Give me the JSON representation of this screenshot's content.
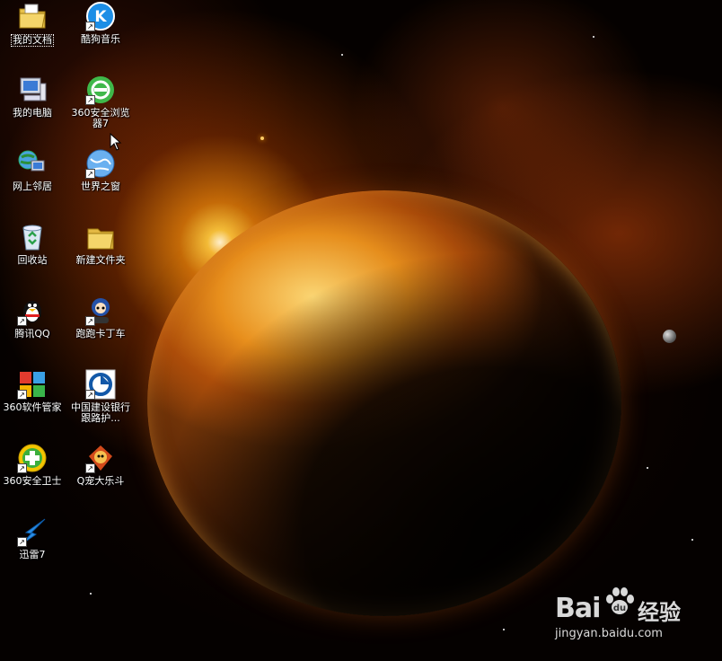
{
  "desktop": {
    "icons": [
      {
        "label": "我的文档",
        "icon": "folder-documents-icon",
        "selected": true,
        "shortcut": false
      },
      {
        "label": "酷狗音乐",
        "icon": "kugou-music-icon",
        "selected": false,
        "shortcut": true
      },
      {
        "label": "我的电脑",
        "icon": "my-computer-icon",
        "selected": false,
        "shortcut": false
      },
      {
        "label": "360安全浏览器7",
        "icon": "360-browser-icon",
        "selected": false,
        "shortcut": true
      },
      {
        "label": "网上邻居",
        "icon": "network-places-icon",
        "selected": false,
        "shortcut": false
      },
      {
        "label": "世界之窗",
        "icon": "theworld-browser-icon",
        "selected": false,
        "shortcut": true
      },
      {
        "label": "回收站",
        "icon": "recycle-bin-icon",
        "selected": false,
        "shortcut": false
      },
      {
        "label": "新建文件夹",
        "icon": "folder-icon",
        "selected": false,
        "shortcut": false
      },
      {
        "label": "腾讯QQ",
        "icon": "qq-penguin-icon",
        "selected": false,
        "shortcut": true
      },
      {
        "label": "跑跑卡丁车",
        "icon": "kart-rider-icon",
        "selected": false,
        "shortcut": true
      },
      {
        "label": "360软件管家",
        "icon": "360-software-manager-icon",
        "selected": false,
        "shortcut": true
      },
      {
        "label": "中国建设银行跟路护...",
        "icon": "ccb-bank-icon",
        "selected": false,
        "shortcut": true
      },
      {
        "label": "360安全卫士",
        "icon": "360-safeguard-icon",
        "selected": false,
        "shortcut": true
      },
      {
        "label": "Q宠大乐斗",
        "icon": "q-pet-game-icon",
        "selected": false,
        "shortcut": true
      },
      {
        "label": "迅雷7",
        "icon": "thunder-download-icon",
        "selected": false,
        "shortcut": true
      }
    ]
  },
  "watermark": {
    "logo_left": "Bai",
    "logo_right": "经验",
    "url": "jingyan.baidu.com"
  },
  "colors": {
    "sun": "#fff2c0",
    "planet_lit": "#e89a2a",
    "space": "#050100"
  }
}
